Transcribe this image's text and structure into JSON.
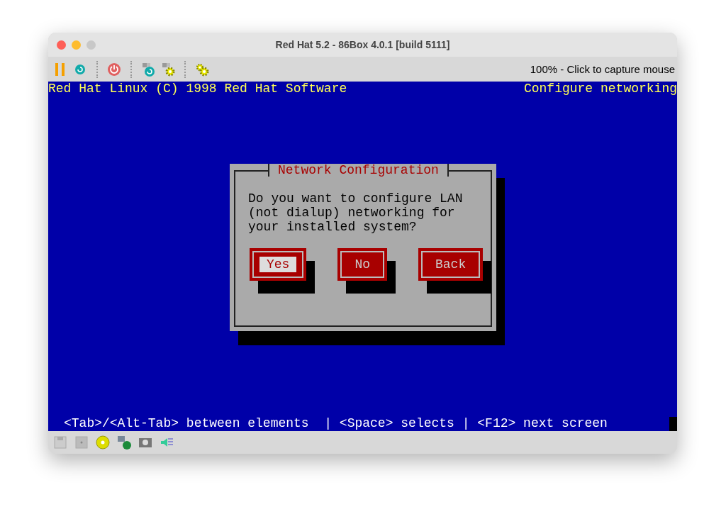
{
  "window": {
    "title": "Red Hat 5.2 - 86Box 4.0.1 [build 5111]"
  },
  "toolbar": {
    "status": "100% - Click to capture mouse"
  },
  "screen": {
    "header_left": "Red Hat Linux (C) 1998 Red Hat Software",
    "header_right": "Configure networking",
    "dialog": {
      "title": "Network Configuration",
      "message": [
        "Do you want to configure LAN",
        "(not dialup) networking for",
        "your installed system?"
      ],
      "buttons": [
        {
          "label": "Yes",
          "selected": true
        },
        {
          "label": "No",
          "selected": false
        },
        {
          "label": "Back",
          "selected": false
        }
      ]
    },
    "hint": "<Tab>/<Alt-Tab> between elements  | <Space> selects | <F12> next screen"
  }
}
